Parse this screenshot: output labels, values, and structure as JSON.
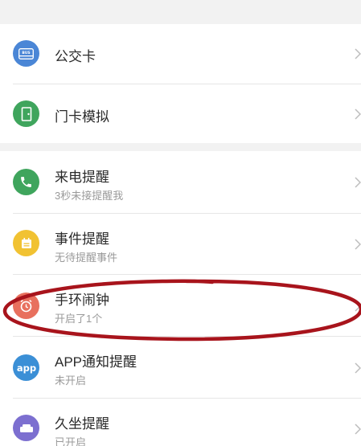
{
  "colors": {
    "background": "#f2f2f2",
    "card": "#ffffff",
    "title_text": "#2a2a2a",
    "subtitle_text": "#9a9a9a",
    "annotation_oval": "#a8141c"
  },
  "section_cards": [
    {
      "title": "公交卡",
      "icon": "bus-card-icon",
      "icon_color": "#4a86d6",
      "icon_text": "BUS"
    },
    {
      "title": "门卡模拟",
      "icon": "door-card-icon",
      "icon_color": "#3fa55d"
    }
  ],
  "section_reminders": [
    {
      "title": "来电提醒",
      "subtitle": "3秒未接提醒我",
      "icon": "phone-icon",
      "icon_color": "#3fa55d"
    },
    {
      "title": "事件提醒",
      "subtitle": "无待提醒事件",
      "icon": "event-icon",
      "icon_color": "#f1c232"
    },
    {
      "title": "手环闹钟",
      "subtitle": "开启了1个",
      "icon": "alarm-clock-icon",
      "icon_color": "#e8705e"
    },
    {
      "title": "APP通知提醒",
      "subtitle": "未开启",
      "icon": "app-icon",
      "icon_color": "#3b8fd6",
      "icon_text": "app"
    },
    {
      "title": "久坐提醒",
      "subtitle": "已开启",
      "icon": "sofa-icon",
      "icon_color": "#7c6fd0"
    }
  ]
}
